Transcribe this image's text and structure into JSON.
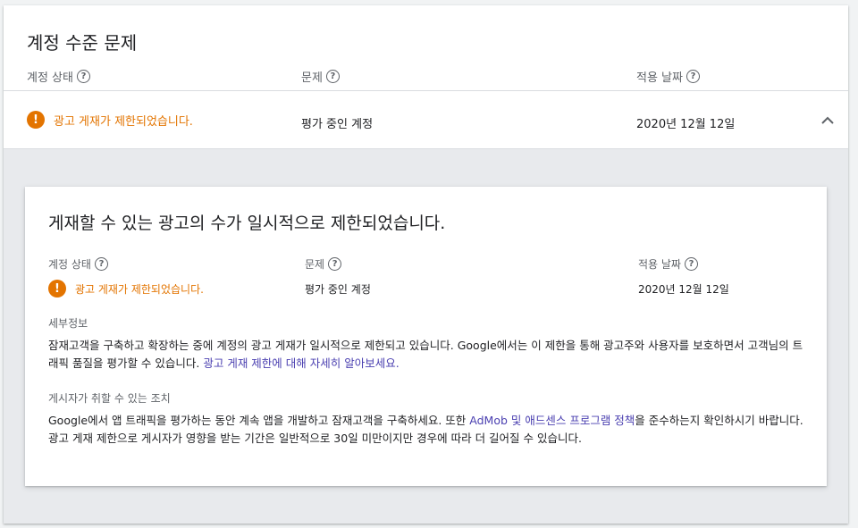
{
  "section": {
    "title": "계정 수준 문제",
    "columns": {
      "status": "계정 상태",
      "issue": "문제",
      "date": "적용 날짜"
    },
    "row": {
      "status": "광고 게재가 제한되었습니다.",
      "issue": "평가 중인 계정",
      "date": "2020년 12월 12일"
    }
  },
  "detail": {
    "title": "게재할 수 있는 광고의 수가 일시적으로 제한되었습니다.",
    "columns": {
      "status": "계정 상태",
      "issue": "문제",
      "date": "적용 날짜"
    },
    "values": {
      "status": "광고 게재가 제한되었습니다.",
      "issue": "평가 중인 계정",
      "date": "2020년 12월 12일"
    },
    "info_heading": "세부정보",
    "info_text": "잠재고객을 구축하고 확장하는 중에 계정의 광고 게재가 일시적으로 제한되고 있습니다. Google에서는 이 제한을 통해 광고주와 사용자를 보호하면서 고객님의 트래픽 품질을 평가할 수 있습니다. ",
    "info_link": "광고 게재 제한에 대해 자세히 알아보세요.",
    "action_heading": "게시자가 취할 수 있는 조치",
    "action_text_1": "Google에서 앱 트래픽을 평가하는 동안 계속 앱을 개발하고 잠재고객을 구축하세요. 또한 ",
    "action_link": "AdMob 및 애드센스 프로그램 정책",
    "action_text_2": "을 준수하는지 확인하시기 바랍니다. 광고 게재 제한으로 게시자가 영향을 받는 기간은 일반적으로 30일 미만이지만 경우에 따라 더 길어질 수 있습니다."
  },
  "icons": {
    "help": "help-circle-icon",
    "warning": "warning-circle-icon",
    "chevron": "chevron-up-icon",
    "help_glyph": "?",
    "warning_glyph": "!"
  },
  "colors": {
    "warning": "#e37400",
    "link": "#4a3fb0"
  }
}
